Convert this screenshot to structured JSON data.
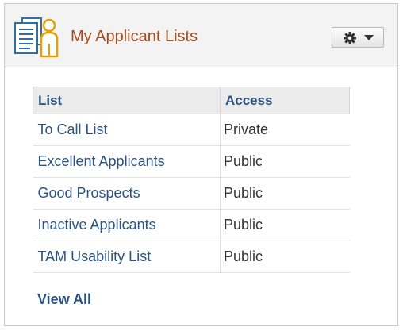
{
  "pagelet": {
    "title": "My Applicant Lists",
    "icon": "applicant-list-icon",
    "actions_icon": "gear-icon",
    "actions_menu_icon": "dropdown-arrow-icon"
  },
  "table": {
    "headers": [
      "List",
      "Access"
    ],
    "rows": [
      {
        "list": "To Call List",
        "access": "Private"
      },
      {
        "list": "Excellent Applicants",
        "access": "Public"
      },
      {
        "list": "Good Prospects",
        "access": "Public"
      },
      {
        "list": "Inactive Applicants",
        "access": "Public"
      },
      {
        "list": "TAM Usability List",
        "access": "Public"
      }
    ]
  },
  "footer": {
    "view_all_label": "View All"
  },
  "colors": {
    "title": "#a34a1e",
    "link": "#2a5481",
    "header_bg": "#f3f3f3"
  }
}
